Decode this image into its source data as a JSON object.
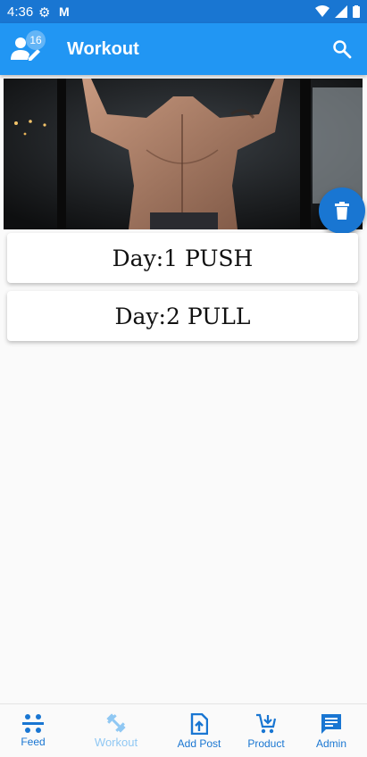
{
  "status_bar": {
    "time": "4:36"
  },
  "app_bar": {
    "title": "Workout",
    "badge_count": "16"
  },
  "days": [
    {
      "label": "Day:1 PUSH"
    },
    {
      "label": "Day:2 PULL"
    }
  ],
  "bottom_nav": [
    {
      "label": "Feed",
      "icon": "feed-icon",
      "active": true
    },
    {
      "label": "Workout",
      "icon": "dumbbell-icon",
      "active": false
    },
    {
      "label": "Add Post",
      "icon": "add-post-icon",
      "active": true
    },
    {
      "label": "Product",
      "icon": "cart-add-icon",
      "active": true
    },
    {
      "label": "Admin",
      "icon": "chat-icon",
      "active": true
    }
  ],
  "colors": {
    "primary": "#2196f3",
    "primary_dark": "#1976d2",
    "badge": "#64b5f6",
    "inactive_nav": "#90c8f3"
  }
}
